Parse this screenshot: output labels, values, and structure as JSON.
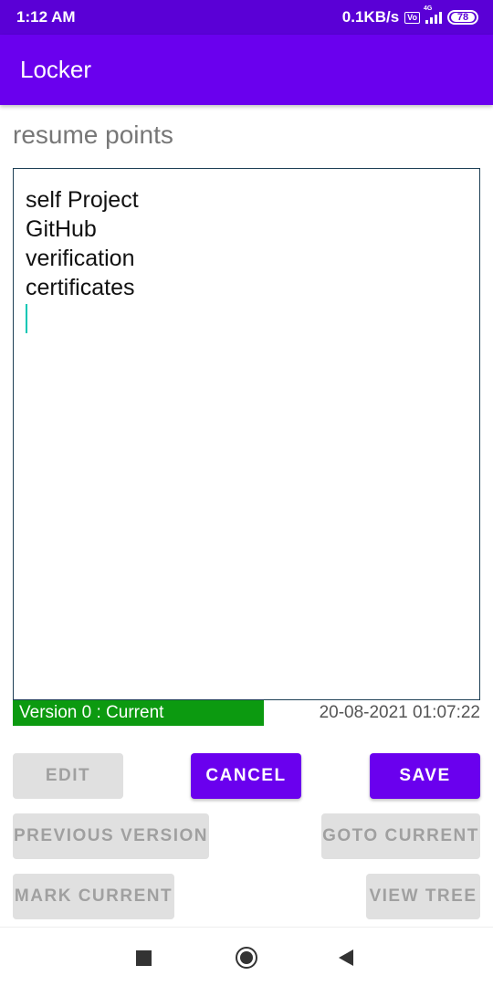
{
  "status_bar": {
    "time": "1:12 AM",
    "network_speed": "0.1KB/s",
    "volte": "VoLTE",
    "network_type": "4G",
    "battery": "78"
  },
  "app_bar": {
    "title": "Locker"
  },
  "note": {
    "title": "resume points",
    "lines": [
      "self Project",
      "GitHub",
      "verification",
      "certificates"
    ]
  },
  "version": {
    "label": "Version 0 : Current",
    "timestamp": "20-08-2021 01:07:22"
  },
  "buttons": {
    "edit": "EDIT",
    "cancel": "CANCEL",
    "save": "SAVE",
    "previous_version": "PREVIOUS VERSION",
    "goto_current": "GOTO CURRENT",
    "mark_current": "MARK CURRENT",
    "view_tree": "VIEW TREE"
  },
  "colors": {
    "app_bar": "#6a00ee",
    "status_bar": "#5a00d6",
    "primary_button": "#6a00ee",
    "version_bar": "#0c9a10",
    "cursor": "#00c7b4"
  },
  "icons": {
    "nav_recents": "square-icon",
    "nav_home": "circle-icon",
    "nav_back": "triangle-back-icon"
  }
}
